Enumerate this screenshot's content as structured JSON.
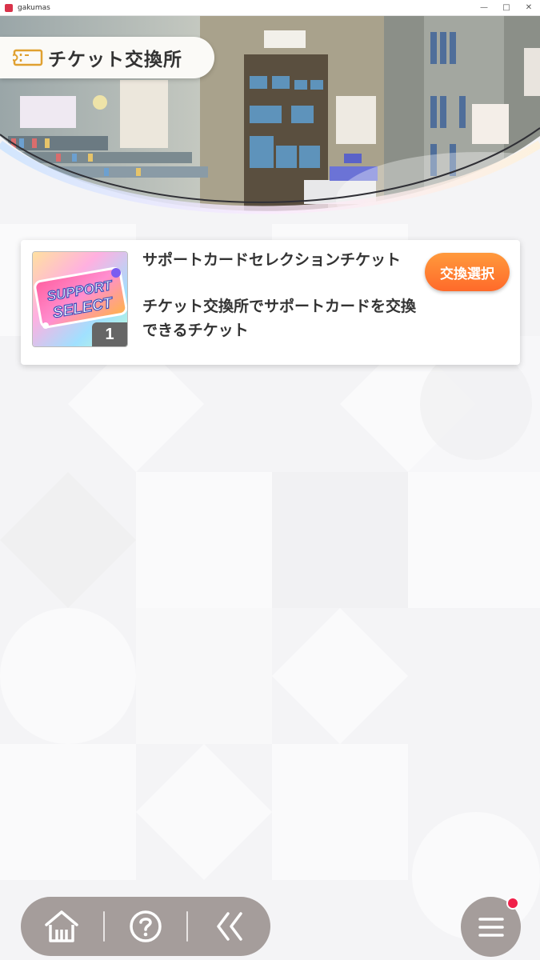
{
  "window": {
    "title": "gakumas",
    "controls": [
      "minimize",
      "maximize",
      "close"
    ]
  },
  "header": {
    "title": "チケット交換所",
    "icon": "ticket-icon"
  },
  "items": [
    {
      "name": "サポートカードセレクションチケット",
      "description": "チケット交換所でサポートカードを交換できるチケット",
      "quantity": "1",
      "thumbnail_text": [
        "SUPPORT",
        "SELECT"
      ],
      "button_label": "交換選択"
    }
  ],
  "bottom_nav": {
    "buttons": [
      "home-icon",
      "help-icon",
      "back-icon"
    ]
  },
  "menu": {
    "icon": "hamburger-menu-icon",
    "has_notification": true
  },
  "colors": {
    "accent_orange": "#ff7a30",
    "nav_gray": "#a59d9b",
    "notification_red": "#f0204a",
    "ticket_gold": "#e0a030"
  }
}
